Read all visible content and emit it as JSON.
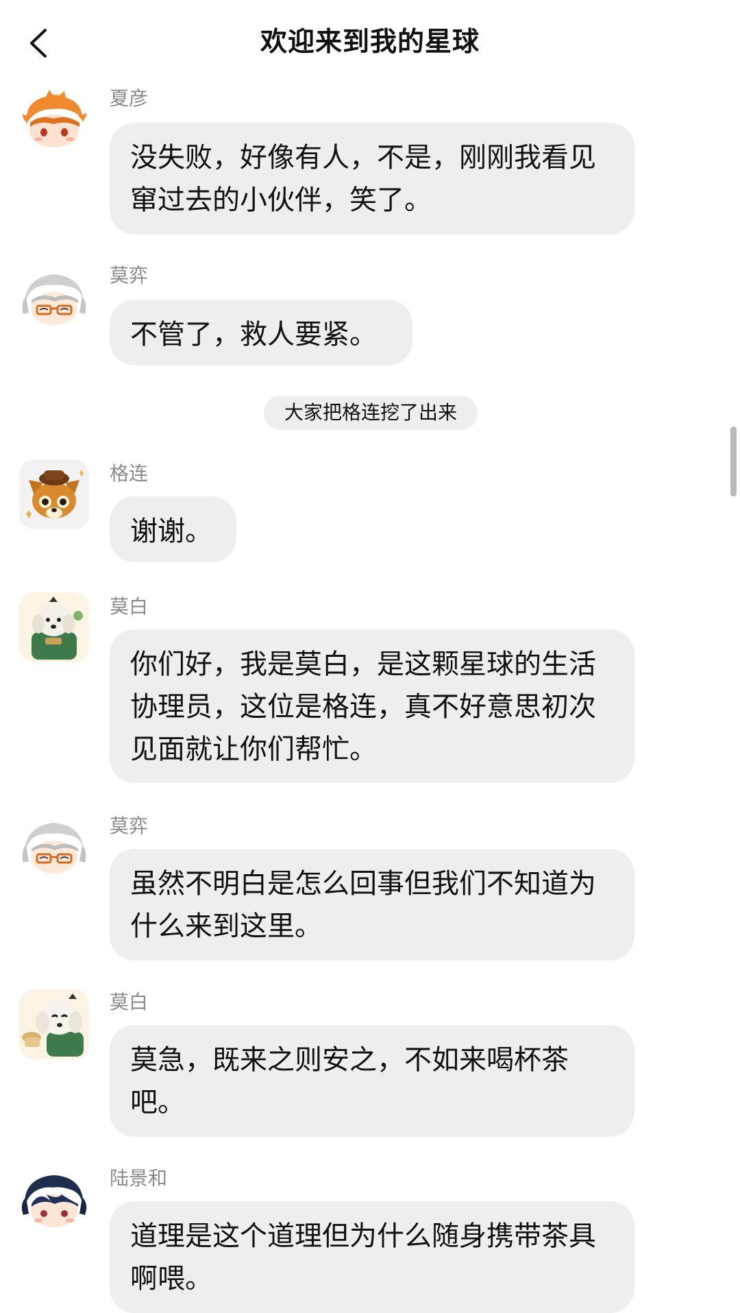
{
  "header": {
    "title": "欢迎来到我的星球",
    "back_icon": "chevron-left-icon"
  },
  "messages": [
    {
      "sender": "夏彦",
      "text": "没失败，好像有人，不是，刚刚我看见窜过去的小伙伴，笑了。",
      "avatar": "orange-hair-boy-avatar"
    },
    {
      "sender": "莫弈",
      "text": "不管了，救人要紧。",
      "avatar": "silver-hair-glasses-avatar"
    },
    {
      "sender": "格连",
      "text": "谢谢。",
      "avatar": "fox-with-hat-avatar"
    },
    {
      "sender": "莫白",
      "text": "你们好，我是莫白，是这颗星球的生活协理员，这位是格连，真不好意思初次见面就让你们帮忙。",
      "avatar": "white-dog-green-coat-avatar"
    },
    {
      "sender": "莫弈",
      "text": "虽然不明白是怎么回事但我们不知道为什么来到这里。",
      "avatar": "silver-hair-glasses-avatar"
    },
    {
      "sender": "莫白",
      "text": "莫急，既来之则安之，不如来喝杯茶吧。",
      "avatar": "white-dog-tea-avatar"
    },
    {
      "sender": "陆景和",
      "text": "道理是这个道理但为什么随身携带茶具啊喂。",
      "avatar": "navy-hair-boy-avatar"
    }
  ],
  "system_tip": "大家把格连挖了出来",
  "colors": {
    "bubble_bg": "#eeeeee",
    "sender_name": "#8a8a8a",
    "text": "#111111",
    "background": "#ffffff"
  }
}
